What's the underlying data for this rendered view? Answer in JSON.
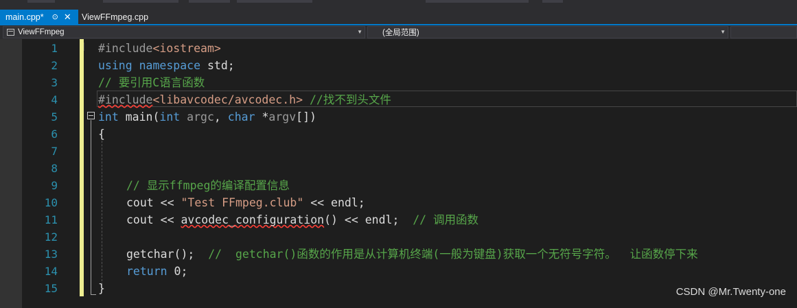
{
  "tabs": [
    {
      "label": "main.cpp*",
      "pin_icon": "pin-icon",
      "close_icon": "close-icon",
      "active": true
    },
    {
      "label": "ViewFFmpeg.cpp",
      "active": false
    }
  ],
  "nav": {
    "project": "ViewFFmpeg",
    "scope": "(全局范围)",
    "member": ""
  },
  "editor": {
    "line_numbers": [
      "1",
      "2",
      "3",
      "4",
      "5",
      "6",
      "7",
      "8",
      "9",
      "10",
      "11",
      "12",
      "13",
      "14",
      "15"
    ],
    "lines": {
      "l1": {
        "directive": "#include",
        "header": "<iostream>"
      },
      "l2": {
        "kw1": "using",
        "kw2": "namespace",
        "rest": " std;"
      },
      "l3": {
        "comment": "// 要引用C语言函数"
      },
      "l4": {
        "directive": "#include",
        "header": "<libavcodec/avcodec.h>",
        "comment": " //找不到头文件"
      },
      "l5": {
        "kw1": "int",
        "name": " main(",
        "kw2": "int",
        "p1": " argc",
        "sep": ", ",
        "kw3": "char",
        "star": " *",
        "p2": "argv",
        "end": "[])"
      },
      "l6": {
        "text": "{"
      },
      "l9": {
        "comment": "// 显示ffmpeg的编译配置信息"
      },
      "l10": {
        "a": "cout << ",
        "str": "\"Test FFmpeg.club\"",
        "b": " << endl;"
      },
      "l11": {
        "a": "cout << ",
        "fn": "avcodec_configuration",
        "b": "() << endl;  ",
        "comment": "// 调用函数"
      },
      "l13": {
        "a": "getchar();  ",
        "comment": "//  getchar()函数的作用是从计算机终端(一般为键盘)获取一个无符号字符。  让函数停下来"
      },
      "l14": {
        "kw": "return",
        "rest": " 0;"
      },
      "l15": {
        "text": "}"
      }
    }
  },
  "watermark": "CSDN @Mr.Twenty-one",
  "colors": {
    "accent": "#007acc",
    "keyword": "#569cd6",
    "comment": "#57a64a",
    "string": "#d69d85",
    "line_number": "#2b91af",
    "changed_bar": "#efef91",
    "error_squiggle": "#fc3e36"
  }
}
